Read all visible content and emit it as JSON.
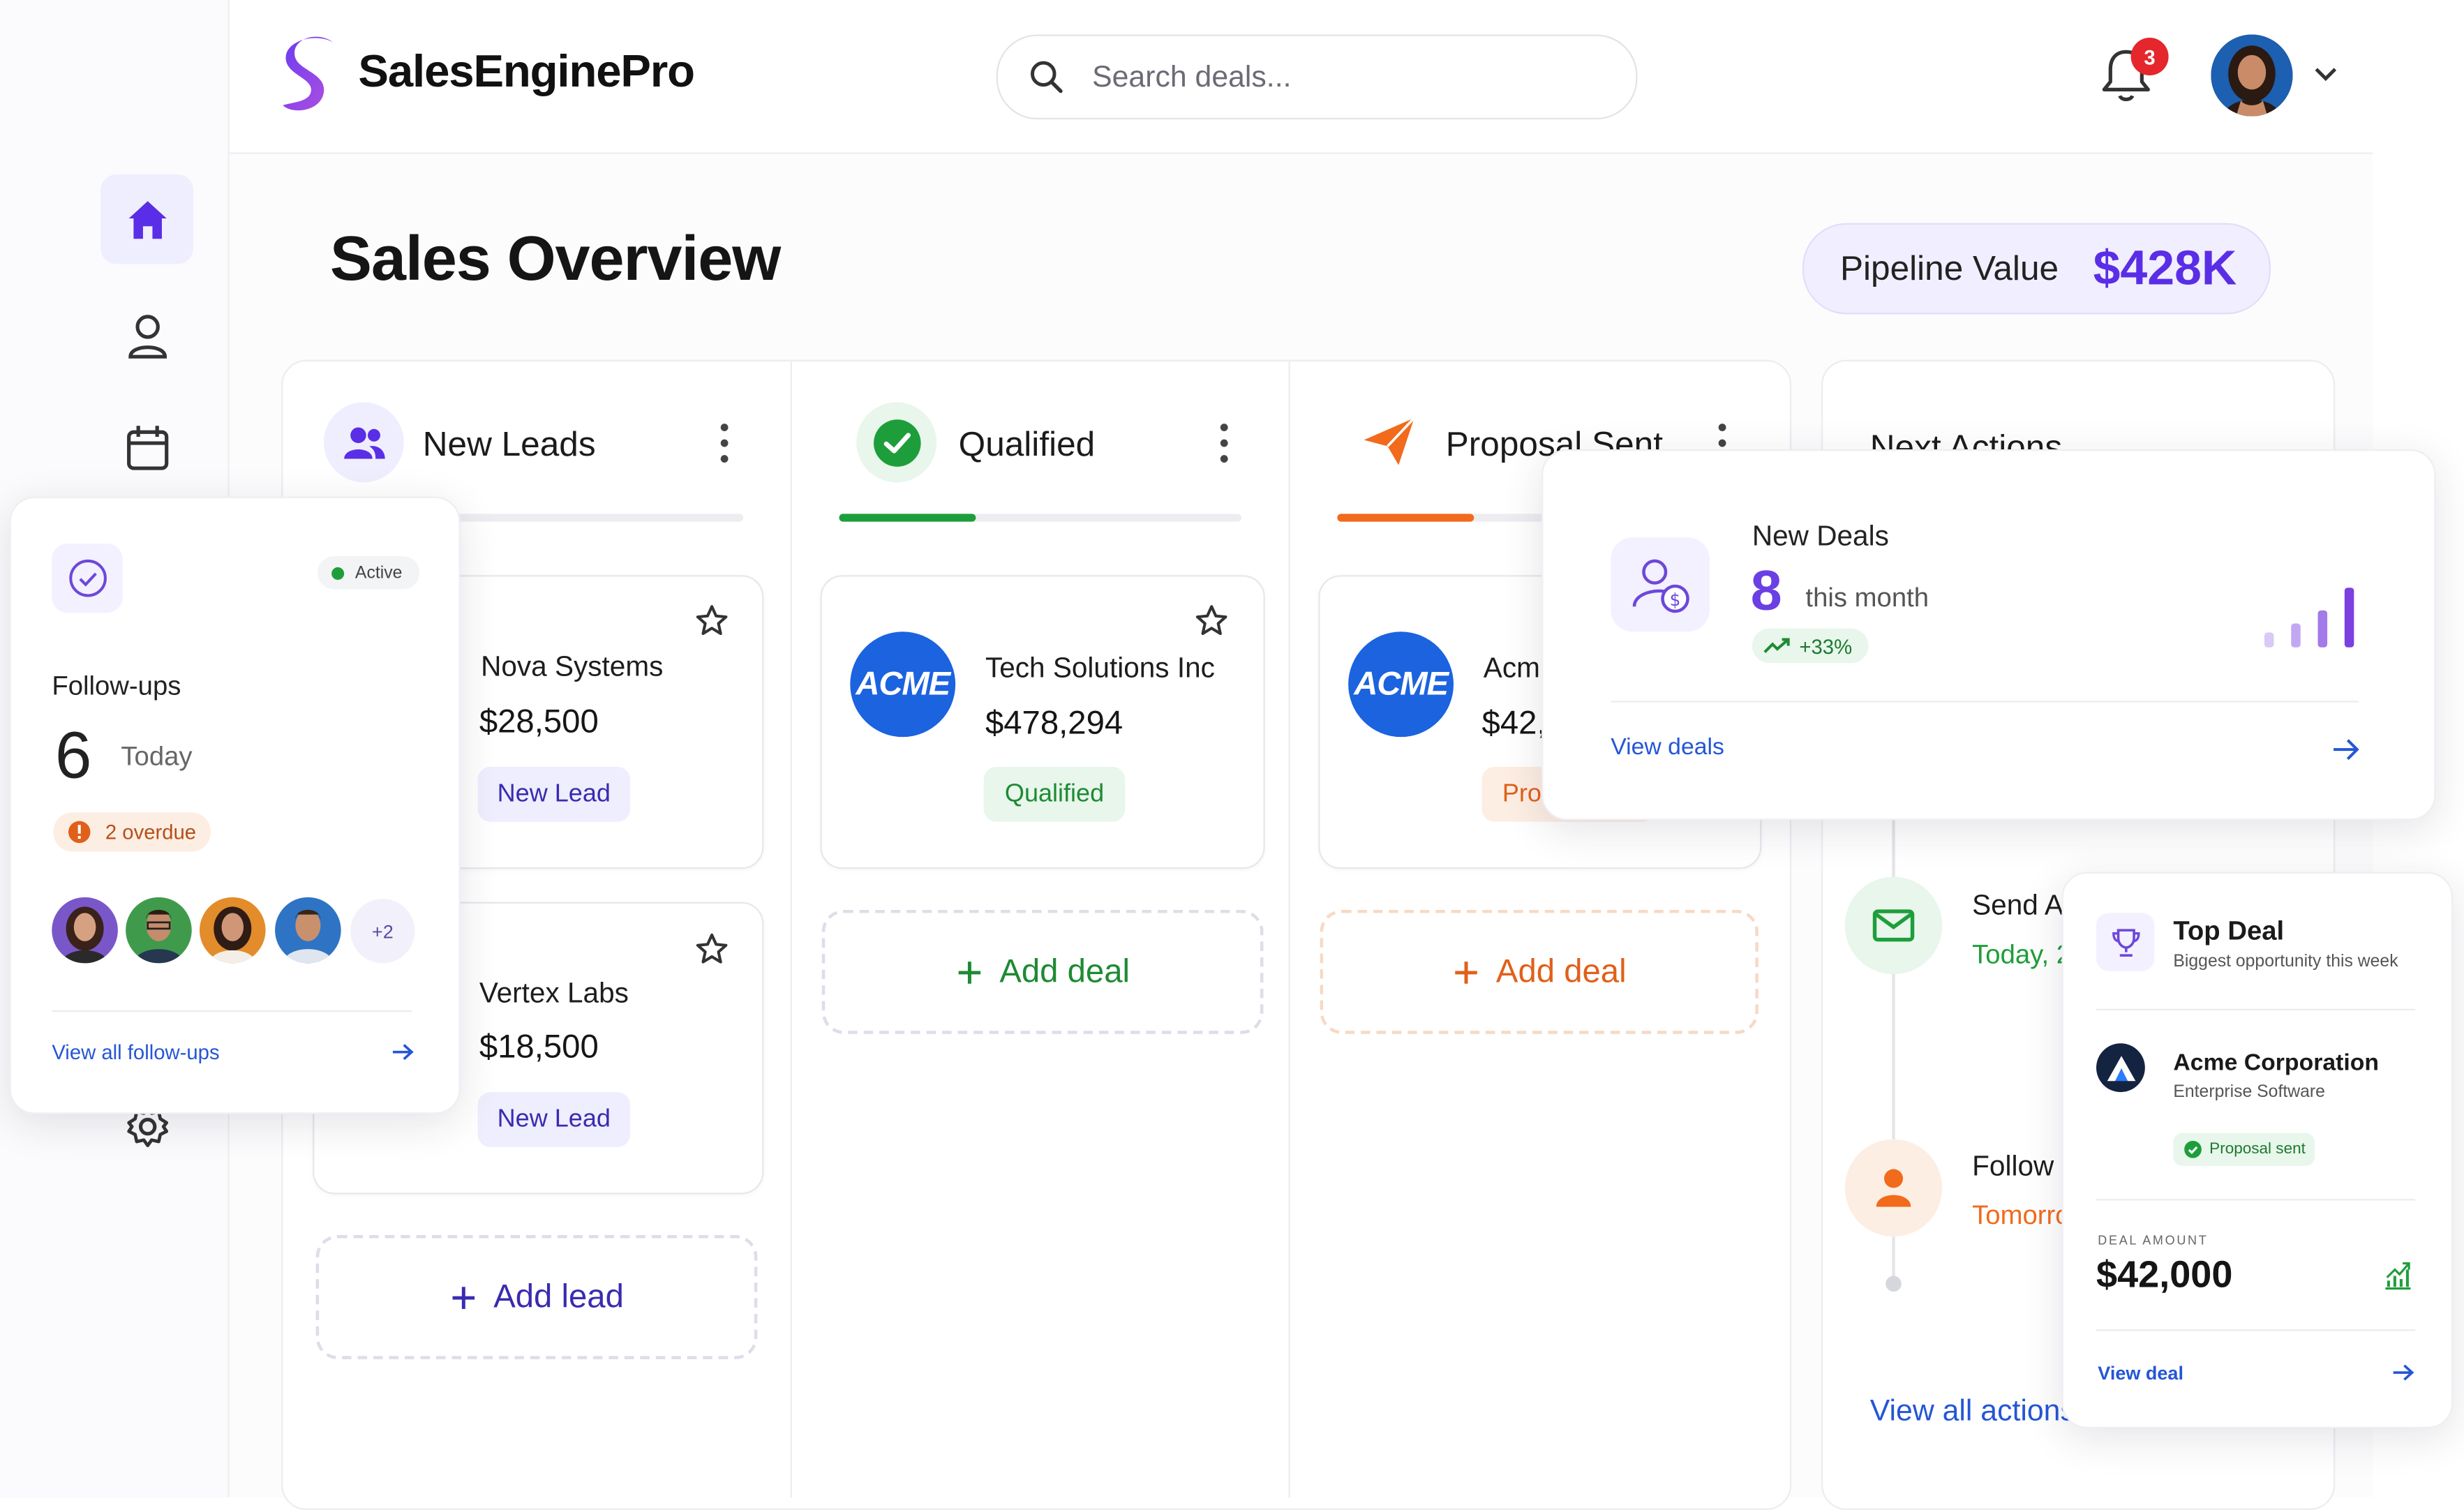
{
  "app": {
    "name": "SalesEnginePro"
  },
  "search": {
    "placeholder": "Search deals..."
  },
  "header": {
    "notification_count": "3"
  },
  "page": {
    "title": "Sales Overview",
    "pipeline_label": "Pipeline Value",
    "pipeline_value": "$428K"
  },
  "columns": [
    {
      "title": "New Leads",
      "progress": 0,
      "deals": [
        {
          "name": "Nova Systems",
          "amount": "$28,500",
          "tag": "New Lead"
        },
        {
          "name": "Vertex Labs",
          "amount": "$18,500",
          "tag": "New Lead"
        }
      ],
      "add_label": "Add lead"
    },
    {
      "title": "Qualified",
      "progress": 0.34,
      "deals": [
        {
          "logo": "ACME",
          "name": "Tech Solutions Inc",
          "amount": "$478,294",
          "tag": "Qualified"
        }
      ],
      "add_label": "Add deal"
    },
    {
      "title": "Proposal Sent",
      "progress": 0.34,
      "deals": [
        {
          "logo": "ACME",
          "name": "Acm",
          "amount": "$42,",
          "tag": "Pro"
        }
      ],
      "add_label": "Add deal"
    }
  ],
  "next_actions": {
    "title": "Next Actions",
    "items": [
      {
        "title": "Send A",
        "when": "Today, 2"
      },
      {
        "title": "Follow u",
        "when": "Tomorro"
      }
    ],
    "view_all": "View all actions"
  },
  "new_deals_card": {
    "title": "New Deals",
    "count": "8",
    "period": "this month",
    "growth": "+33%",
    "link": "View deals",
    "bars": [
      0.25,
      0.4,
      0.62,
      1.0
    ]
  },
  "followups_card": {
    "status": "Active",
    "title": "Follow-ups",
    "count": "6",
    "period": "Today",
    "overdue": "2 overdue",
    "extra_people": "+2",
    "link": "View all follow-ups"
  },
  "top_deal_card": {
    "title": "Top Deal",
    "subtitle": "Biggest opportunity this week",
    "company": "Acme Corporation",
    "company_type": "Enterprise Software",
    "status": "Proposal sent",
    "amount_label": "DEAL AMOUNT",
    "amount": "$42,000",
    "link": "View deal"
  },
  "colors": {
    "accent": "#5a2ee6",
    "green": "#1e9e3a",
    "orange": "#f26a1b",
    "link": "#2456d6"
  },
  "icons": [
    "home-icon",
    "user-icon",
    "calendar-icon",
    "settings-icon",
    "search-icon",
    "bell-icon",
    "chevron-down-icon",
    "users-icon",
    "check-circle-icon",
    "send-icon",
    "star-icon",
    "plus-icon",
    "mail-icon",
    "person-icon",
    "user-dollar-icon",
    "trend-up-icon",
    "arrow-right-icon",
    "trophy-icon",
    "alert-icon"
  ]
}
